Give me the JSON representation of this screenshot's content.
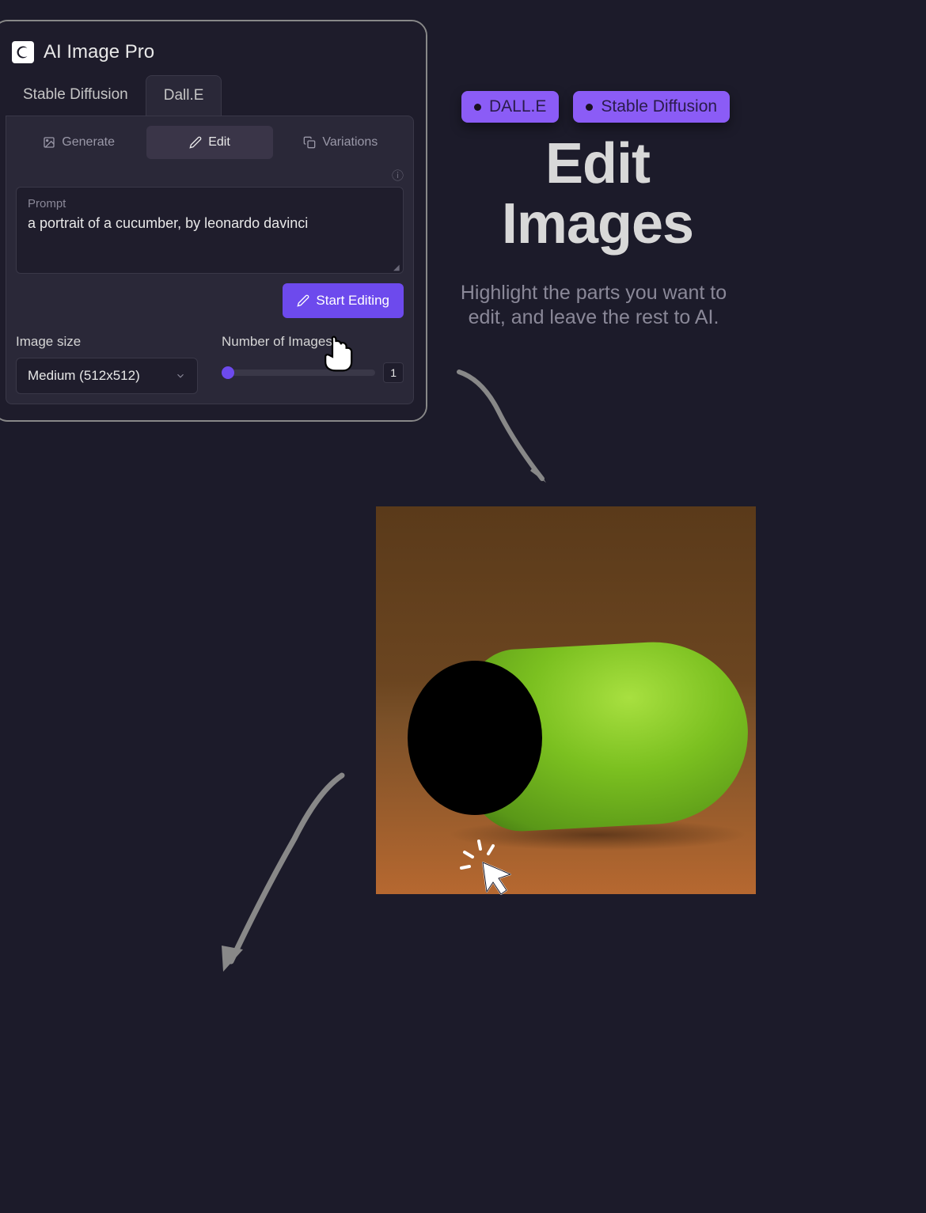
{
  "app": {
    "title": "AI Image Pro",
    "modelTabs": [
      "Stable Diffusion",
      "Dall.E"
    ],
    "activeModelTab": 1,
    "actionTabs": [
      {
        "label": "Generate",
        "icon": "image-icon"
      },
      {
        "label": "Edit",
        "icon": "pencil-icon"
      },
      {
        "label": "Variations",
        "icon": "copy-icon"
      }
    ],
    "activeActionTab": 1,
    "prompt": {
      "label": "Prompt",
      "value": "a portrait of a cucumber, by leonardo davinci"
    },
    "startButton": "Start Editing",
    "imageSize": {
      "label": "Image size",
      "value": "Medium (512x512)"
    },
    "numImages": {
      "label": "Number of Images",
      "value": "1"
    }
  },
  "hero": {
    "badges": [
      "DALL.E",
      "Stable Diffusion"
    ],
    "titleLine1": "Edit",
    "titleLine2": "Images",
    "subtitle": "Highlight the parts you want to edit, and leave the rest to AI."
  }
}
